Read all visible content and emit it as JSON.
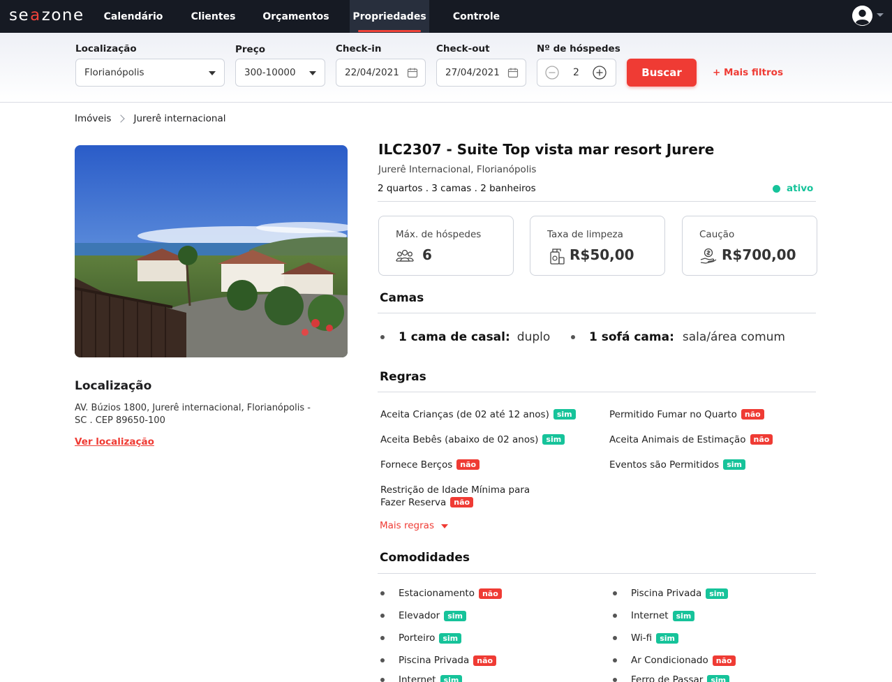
{
  "brand": {
    "logo_text_1": "se",
    "logo_mark": "a",
    "logo_text_2": "zone",
    "accent_color": "#ef3b34",
    "success_color": "#16c39a"
  },
  "nav": {
    "items": [
      {
        "label": "Calendário"
      },
      {
        "label": "Clientes"
      },
      {
        "label": "Orçamentos"
      },
      {
        "label": "Propriedades",
        "active": true
      },
      {
        "label": "Controle"
      }
    ],
    "user_icon": "user-circle-icon"
  },
  "filters": {
    "location": {
      "label": "Localização",
      "value": "Florianópolis"
    },
    "price": {
      "label": "Preço",
      "value": "300-10000"
    },
    "checkin": {
      "label": "Check-in",
      "value": "22/04/2021"
    },
    "checkout": {
      "label": "Check-out",
      "value": "27/04/2021"
    },
    "guests": {
      "label": "Nº de hóspedes",
      "value": "2"
    },
    "search_button": "Buscar",
    "more_filters": "+ Mais filtros"
  },
  "breadcrumb": {
    "root": "Imóveis",
    "current": "Jurerê internacional"
  },
  "property": {
    "title": "ILC2307 - Suite Top vista mar resort Jurere",
    "subtitle": "Jurerê Internacional, Florianópolis",
    "rooms": "2 quartos . 3 camas . 2 banheiros",
    "status": "ativo"
  },
  "cards": {
    "guests": {
      "label": "Máx. de hóspedes",
      "value": "6",
      "icon": "people-icon"
    },
    "cleaning": {
      "label": "Taxa de limpeza",
      "value": "R$50,00",
      "icon": "cleaning-icon"
    },
    "deposit": {
      "label": "Caução",
      "value": "R$700,00",
      "icon": "money-hand-icon"
    }
  },
  "location": {
    "title": "Localização",
    "address": "AV. Búzios 1800, Jurerê internacional, Florianópolis - SC . CEP 89650-100",
    "link": "Ver localização"
  },
  "beds": {
    "title": "Camas",
    "items": [
      {
        "name": "1 cama de casal:",
        "value": "duplo"
      },
      {
        "name": "1 sofá cama:",
        "value": "sala/área comum"
      }
    ]
  },
  "rules": {
    "title": "Regras",
    "items": [
      {
        "text": "Aceita Crianças (de 02 até 12 anos)",
        "badge": "sim"
      },
      {
        "text": "Aceita Bebês (abaixo de 02 anos)",
        "badge": "sim"
      },
      {
        "text": "Fornece Berços",
        "badge": "não"
      },
      {
        "text_line1": "Restrição de Idade Mínima para",
        "text_line2": "Fazer Reserva",
        "badge": "não"
      },
      {
        "text": "Permitido Fumar no Quarto",
        "badge": "não"
      },
      {
        "text": "Aceita Animais de Estimação",
        "badge": "não"
      },
      {
        "text": "Eventos são Permitidos",
        "badge": "sim"
      }
    ],
    "more": "Mais regras"
  },
  "amenities": {
    "title": "Comodidades",
    "left": [
      {
        "text": "Estacionamento",
        "badge": "não"
      },
      {
        "text": "Elevador",
        "badge": "sim"
      },
      {
        "text": "Porteiro",
        "badge": "sim"
      },
      {
        "text": "Piscina Privada",
        "badge": "não"
      },
      {
        "text": "Internet",
        "badge": "sim"
      }
    ],
    "right": [
      {
        "text": "Piscina Privada",
        "badge": "sim"
      },
      {
        "text": "Internet",
        "badge": "sim"
      },
      {
        "text": "Wi-fi",
        "badge": "sim"
      },
      {
        "text": "Ar Condicionado",
        "badge": "não"
      },
      {
        "text": "Ferro de Passar",
        "badge": "sim"
      }
    ]
  }
}
